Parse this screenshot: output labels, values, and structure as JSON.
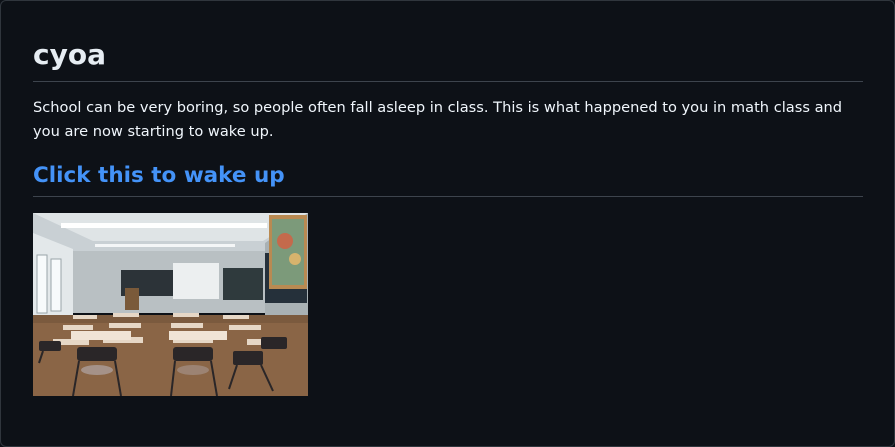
{
  "page": {
    "title": "cyoa",
    "intro": "School can be very boring, so people often fall asleep in class. This is what happened to you in math class and you are now starting to wake up.",
    "link_text": "Click this to wake up"
  },
  "image": {
    "subject": "empty classroom with desks, chalkboard and wall map"
  },
  "colors": {
    "background": "#0d1117",
    "text": "#e6edf3",
    "link": "#4493f8",
    "divider": "#3d444d"
  }
}
